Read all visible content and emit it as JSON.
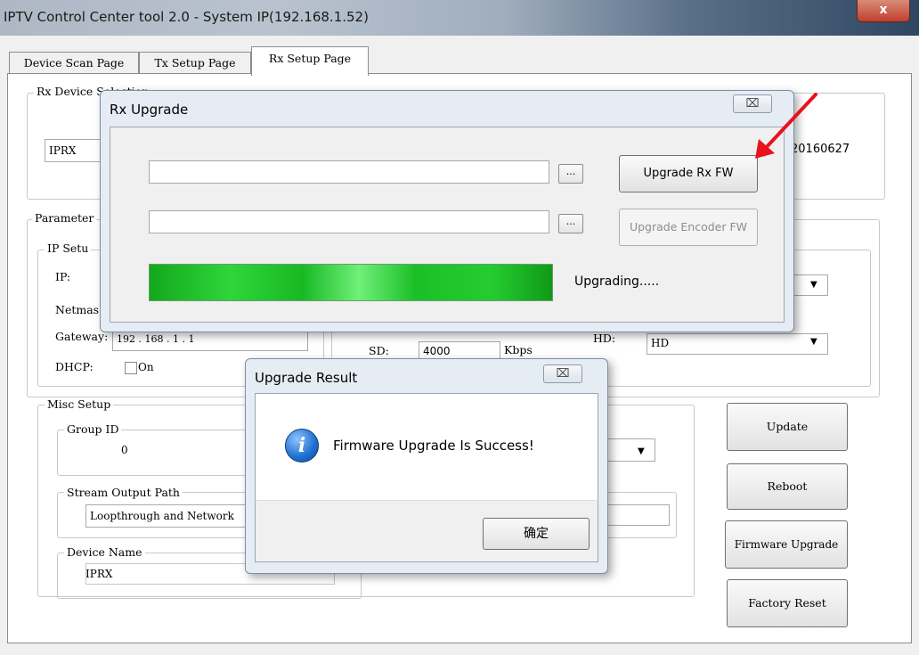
{
  "window": {
    "title": "IPTV Control Center tool 2.0 - System IP(192.168.1.52)",
    "close_label": "x"
  },
  "tabs": [
    {
      "label": "Device Scan Page"
    },
    {
      "label": "Tx Setup Page"
    },
    {
      "label": "Rx Setup Page"
    }
  ],
  "rx_setup": {
    "rx_device_selection_label": "Rx Device Selection",
    "rx_device_value": "IPRX",
    "version_text": "20160627",
    "parameters_label": "Parameter",
    "ip_setup_label": "IP Setu",
    "ip_label": "IP:",
    "netmask_label": "Netmas",
    "gateway_label": "Gateway:",
    "gateway_value": "192 . 168 . 1 . 1",
    "dhcp_label": "DHCP:",
    "dhcp_on_label": "On",
    "sd_label": "SD:",
    "sd_value": "4000",
    "kbps_label": "Kbps",
    "hd_label": "HD:",
    "hd_value": "HD",
    "misc_setup_label": "Misc Setup",
    "group_id_label": "Group ID",
    "group_id_value": "0",
    "stream_output_path_label": "Stream Output Path",
    "stream_output_path_value": "Loopthrough and Network",
    "device_name_label": "Device Name",
    "device_name_value": "IPRX",
    "update_button": "Update",
    "reboot_button": "Reboot",
    "firmware_upgrade_button": "Firmware Upgrade",
    "factory_reset_button": "Factory Reset"
  },
  "rx_upgrade_dialog": {
    "title": "Rx Upgrade",
    "close_label": "⌧",
    "browse_label": "...",
    "upgrade_rx_fw_button": "Upgrade Rx FW",
    "upgrade_encoder_fw_button": "Upgrade Encoder FW",
    "status_text": "Upgrading.....",
    "progress": 1.0
  },
  "upgrade_result_dialog": {
    "title": "Upgrade Result",
    "close_label": "⌧",
    "message": "Firmware Upgrade Is Success!",
    "ok_button": "确定",
    "info_icon_glyph": "i"
  },
  "colors": {
    "progress_green": "#25cc30",
    "arrow_red": "#e8121c",
    "info_blue": "#1d6fd0"
  }
}
